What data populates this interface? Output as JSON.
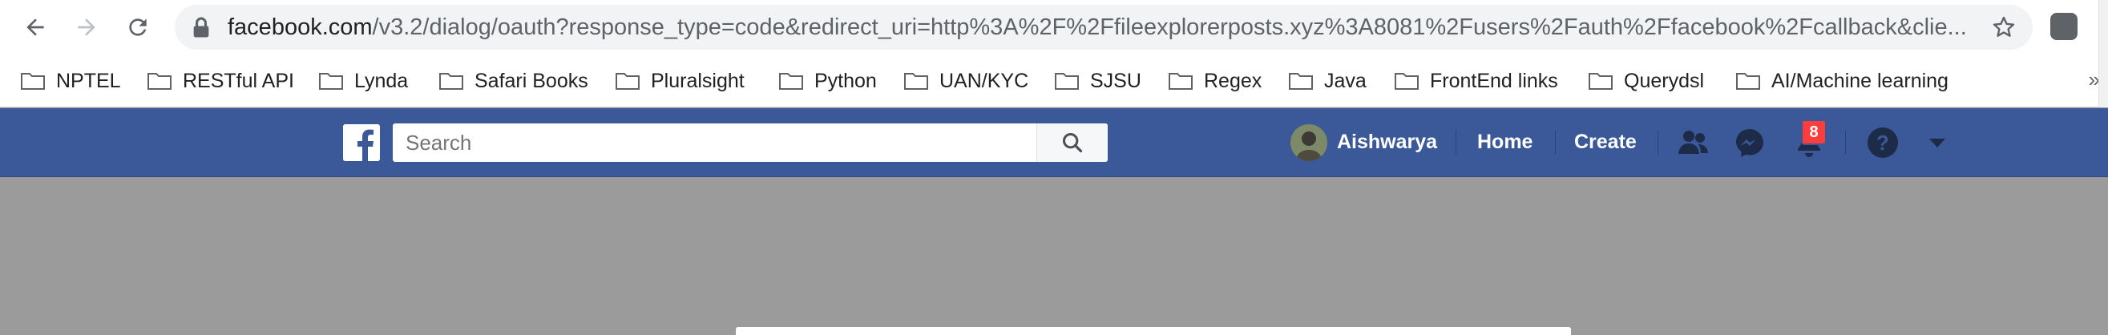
{
  "browser": {
    "url_host": "facebook.com",
    "url_rest": "/v3.2/dialog/oauth?response_type=code&redirect_uri=http%3A%2F%2Ffileexplorerposts.xyz%3A8081%2Fusers%2Fauth%2Ffacebook%2Fcallback&clie...",
    "bookmarks": [
      "NPTEL",
      "RESTful API",
      "Lynda",
      "Safari Books",
      "Pluralsight",
      "Python",
      "UAN/KYC",
      "SJSU",
      "Regex",
      "Java",
      "FrontEnd links",
      "Querydsl",
      "AI/Machine learning"
    ],
    "more_bookmarks": "»"
  },
  "facebook": {
    "search_placeholder": "Search",
    "user_name": "Aishwarya",
    "home_label": "Home",
    "create_label": "Create",
    "notifications_count": "8",
    "colors": {
      "bar": "#3b5998",
      "badge": "#fa3e3e"
    }
  }
}
